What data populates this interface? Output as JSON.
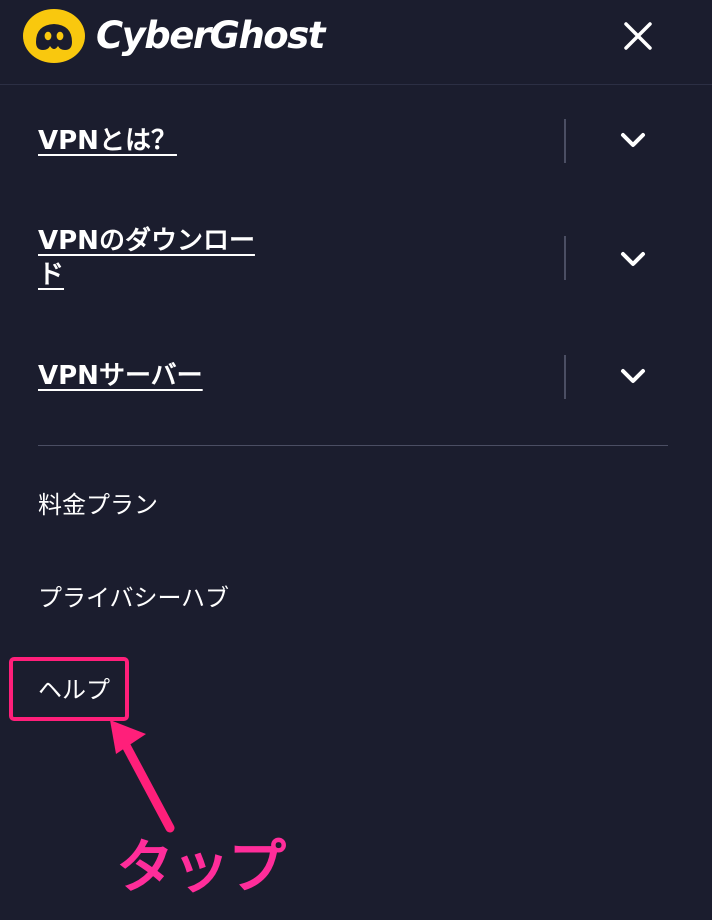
{
  "header": {
    "brand": "CyberGhost",
    "brand_color": "#f9c80e",
    "logo_icon": "ghost-face-icon",
    "close_icon": "close-icon"
  },
  "nav": {
    "items": [
      {
        "label": "VPNとは？",
        "icon": "chevron-down-icon"
      },
      {
        "label_line1": "VPNのダウンロー",
        "label_line2": "ド",
        "icon": "chevron-down-icon"
      },
      {
        "label": "VPNサーバー",
        "icon": "chevron-down-icon"
      }
    ]
  },
  "links": [
    {
      "label": "料金プラン"
    },
    {
      "label": "プライバシーハブ"
    },
    {
      "label": "ヘルプ"
    }
  ],
  "annotation": {
    "text": "タップ",
    "color": "#ff2d9a",
    "box_color": "#ff1f7a"
  }
}
